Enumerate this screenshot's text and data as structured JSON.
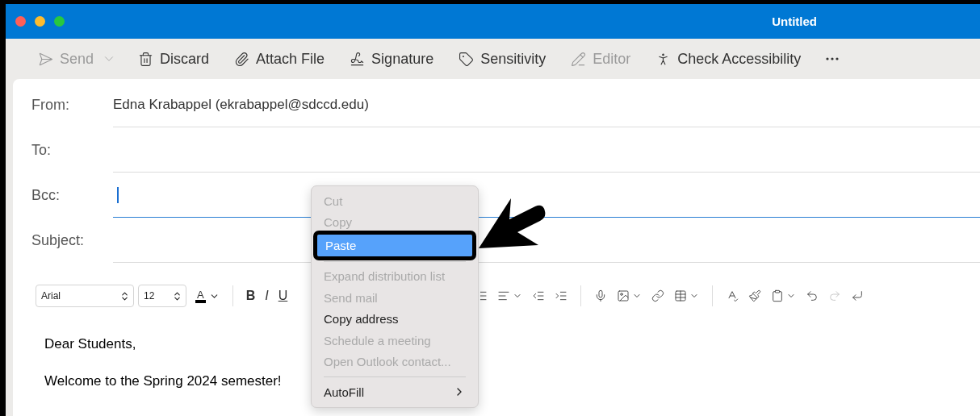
{
  "window": {
    "title": "Untitled"
  },
  "toolbar": [
    {
      "kind": "button",
      "label": "Send",
      "disabled": true
    },
    {
      "kind": "button",
      "label": "Discard",
      "disabled": false
    },
    {
      "kind": "button",
      "label": "Attach File",
      "disabled": false
    },
    {
      "kind": "button",
      "label": "Signature",
      "disabled": false
    },
    {
      "kind": "button",
      "label": "Sensitivity",
      "disabled": false
    },
    {
      "kind": "button",
      "label": "Editor",
      "disabled": true
    },
    {
      "kind": "button",
      "label": "Check Accessibility",
      "disabled": false
    },
    {
      "kind": "more",
      "disabled": false
    }
  ],
  "fields": [
    {
      "label": "From:",
      "value": "Edna Krabappel (ekrabappel@sdccd.edu)",
      "focused": false
    },
    {
      "label": "To:",
      "focused": false
    },
    {
      "label": "Bcc:",
      "focused": true
    },
    {
      "label": "Subject:",
      "focused": false
    }
  ],
  "format_bar": {
    "font": "Arial",
    "size": "12",
    "text_tools": [
      {
        "kind": "color",
        "glyph": "A"
      },
      {
        "kind": "bold",
        "glyph": "B"
      },
      {
        "kind": "italic",
        "glyph": "I"
      },
      {
        "kind": "underline",
        "glyph": "U"
      }
    ],
    "icons": [
      {
        "disabled": false
      },
      {
        "disabled": false
      },
      {
        "disabled": false
      },
      {
        "disabled": false
      },
      {
        "disabled": false
      },
      {
        "disabled": false
      },
      {
        "disabled": false
      },
      {
        "disabled": false
      },
      {
        "disabled": false
      },
      {
        "disabled": false
      },
      {
        "disabled": false
      },
      {
        "disabled": false
      },
      {
        "disabled": true
      },
      {
        "disabled": false
      }
    ]
  },
  "body": [
    "Dear Students,",
    "Welcome to the Spring 2024 semester!"
  ],
  "context_menu": {
    "groups": [
      [
        {
          "label": "Cut",
          "disabled": true,
          "selected": false,
          "submenu": false
        },
        {
          "label": "Copy",
          "disabled": true,
          "selected": false,
          "submenu": false
        },
        {
          "label": "Paste",
          "disabled": false,
          "selected": true,
          "submenu": false
        }
      ],
      [
        {
          "label": "Expand distribution list",
          "disabled": true,
          "selected": false,
          "submenu": false
        },
        {
          "label": "Send mail",
          "disabled": true,
          "selected": false,
          "submenu": false
        },
        {
          "label": "Copy address",
          "disabled": false,
          "selected": false,
          "submenu": false
        },
        {
          "label": "Schedule a meeting",
          "disabled": true,
          "selected": false,
          "submenu": false
        },
        {
          "label": "Open Outlook contact...",
          "disabled": true,
          "selected": false,
          "submenu": false
        }
      ],
      [
        {
          "label": "AutoFill",
          "disabled": false,
          "selected": false,
          "submenu": true
        }
      ]
    ]
  }
}
